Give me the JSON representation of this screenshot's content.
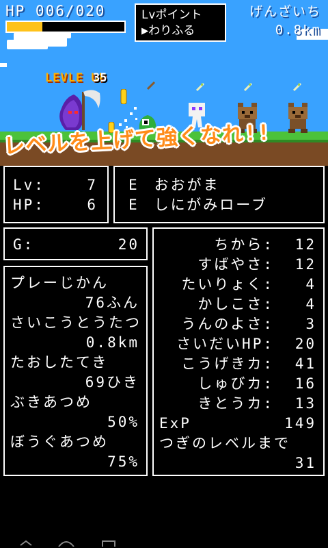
{
  "hud": {
    "hp_text": "HP 006/020",
    "hp_fraction": 0.3,
    "hp_bar_color": "#ffc21a",
    "lv_point_label": "Lvポイント",
    "lv_point_action": "▶わりふる",
    "distance_label": "げんざいち",
    "distance_value": "0.8km"
  },
  "scene": {
    "level_up_text": "LEVLE UP",
    "level_up_number": "35",
    "banner_text": "レベルを上げて強くなれ!!",
    "player_icon": "grim-reaper-icon",
    "enemy_icons": [
      "green-slime-icon",
      "white-ghost-icon",
      "brown-bear-icon",
      "brown-bear-icon"
    ]
  },
  "status": {
    "lv_label": "Lv:",
    "lv_value": "7",
    "hp_label": "HP:",
    "hp_value": "6"
  },
  "equipment": [
    {
      "mark": "E",
      "name": "おおがま"
    },
    {
      "mark": "E",
      "name": "しにがみローブ"
    }
  ],
  "gold": {
    "label": "G:",
    "value": "20"
  },
  "records": [
    {
      "label": "プレーじかん",
      "value": "76ふん"
    },
    {
      "label": "さいこうとうたつ",
      "value": "0.8km"
    },
    {
      "label": "たおしたてき",
      "value": "69ひき"
    },
    {
      "label": "ぶきあつめ",
      "value": "50%"
    },
    {
      "label": "ぼうぐあつめ",
      "value": "75%"
    }
  ],
  "stats": [
    {
      "label": "ちから:",
      "value": "12"
    },
    {
      "label": "すばやさ:",
      "value": "12"
    },
    {
      "label": "たいりょく:",
      "value": "4"
    },
    {
      "label": "かしこさ:",
      "value": "4"
    },
    {
      "label": "うんのよさ:",
      "value": "3"
    },
    {
      "label": "さいだいHP:",
      "value": "20"
    },
    {
      "label": "こうげきカ:",
      "value": "41"
    },
    {
      "label": "しゅびカ:",
      "value": "16"
    },
    {
      "label": "きとうカ:",
      "value": "13"
    },
    {
      "label": "ExP",
      "value": "149"
    }
  ],
  "next_level": {
    "label": "つぎのレベルまで",
    "value": "31"
  },
  "colors": {
    "sky": "#39a2ff",
    "grass": "#4cc23a",
    "dirt": "#7a4a24",
    "banner": "#ff8c1a",
    "levelup": "#ffb000"
  }
}
